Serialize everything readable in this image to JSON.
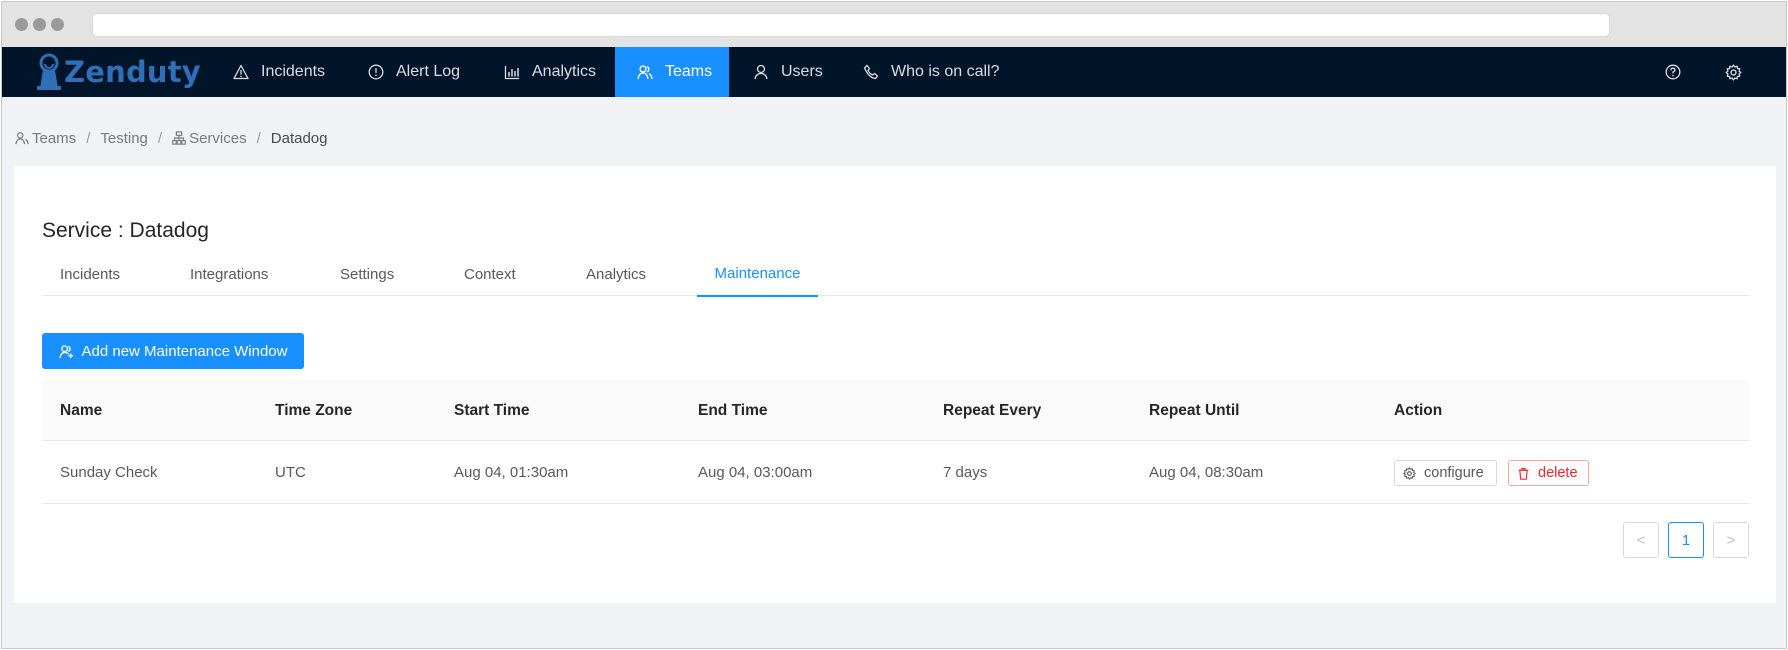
{
  "nav": {
    "logo": "Zenduty",
    "items": [
      {
        "label": "Incidents",
        "icon": "warning-icon"
      },
      {
        "label": "Alert Log",
        "icon": "info-circle-icon"
      },
      {
        "label": "Analytics",
        "icon": "bar-chart-icon"
      },
      {
        "label": "Teams",
        "icon": "team-icon",
        "active": true
      },
      {
        "label": "Users",
        "icon": "user-icon"
      },
      {
        "label": "Who is on call?",
        "icon": "phone-icon"
      }
    ],
    "right_icons": [
      "help-icon",
      "settings-icon"
    ]
  },
  "breadcrumb": {
    "teams": "Teams",
    "team": "Testing",
    "services": "Services",
    "current": "Datadog",
    "separator": "/"
  },
  "page": {
    "title": "Service : Datadog",
    "tabs": [
      {
        "label": "Incidents"
      },
      {
        "label": "Integrations"
      },
      {
        "label": "Settings"
      },
      {
        "label": "Context"
      },
      {
        "label": "Analytics"
      },
      {
        "label": "Maintenance",
        "active": true
      }
    ],
    "add_button": "Add new Maintenance Window"
  },
  "table": {
    "columns": [
      "Name",
      "Time Zone",
      "Start Time",
      "End Time",
      "Repeat Every",
      "Repeat Until",
      "Action"
    ],
    "rows": [
      {
        "name": "Sunday Check",
        "time_zone": "UTC",
        "start_time": "Aug 04, 01:30am",
        "end_time": "Aug 04, 03:00am",
        "repeat_every": "7 days",
        "repeat_until": "Aug 04, 08:30am",
        "actions": {
          "configure": "configure",
          "delete": "delete"
        }
      }
    ]
  },
  "pagination": {
    "prev": "<",
    "current_page": "1",
    "next": ">"
  },
  "colors": {
    "nav_bg": "#001529",
    "accent": "#1890ff",
    "danger": "#f5222d",
    "page_bg": "#f0f2f5"
  }
}
